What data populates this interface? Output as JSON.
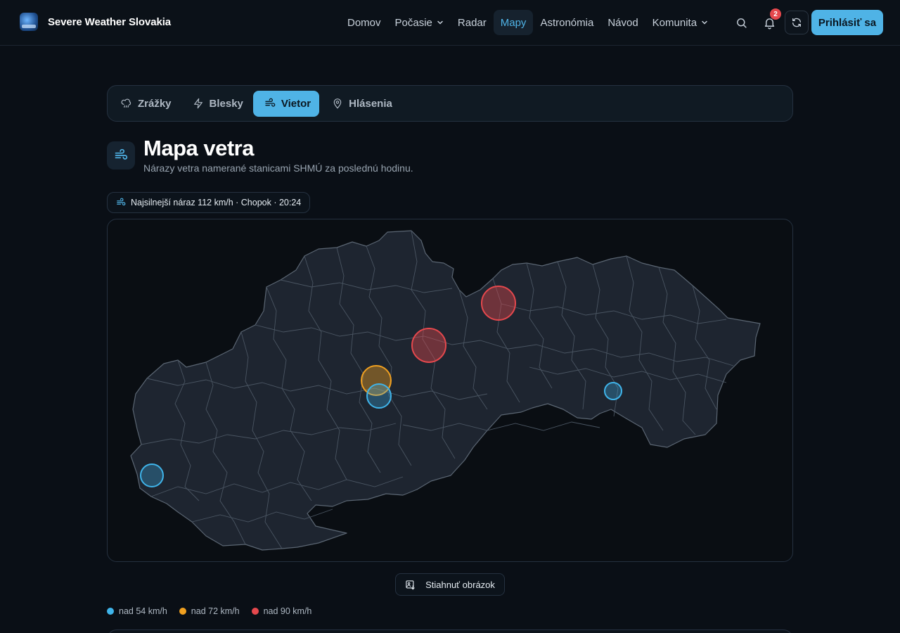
{
  "header": {
    "brand": "Severe Weather Slovakia",
    "nav": [
      {
        "label": "Domov",
        "dropdown": false,
        "active": false
      },
      {
        "label": "Počasie",
        "dropdown": true,
        "active": false
      },
      {
        "label": "Radar",
        "dropdown": false,
        "active": false
      },
      {
        "label": "Mapy",
        "dropdown": false,
        "active": true
      },
      {
        "label": "Astronómia",
        "dropdown": false,
        "active": false
      },
      {
        "label": "Návod",
        "dropdown": false,
        "active": false
      },
      {
        "label": "Komunita",
        "dropdown": true,
        "active": false
      }
    ],
    "notifications_count": "2",
    "login_label": "Prihlásiť sa",
    "icons": [
      "search-icon",
      "bell-icon",
      "refresh-icon"
    ]
  },
  "tabs": [
    {
      "label": "Zrážky",
      "icon": "rain-icon",
      "active": false
    },
    {
      "label": "Blesky",
      "icon": "lightning-icon",
      "active": false
    },
    {
      "label": "Vietor",
      "icon": "wind-icon",
      "active": true
    },
    {
      "label": "Hlásenia",
      "icon": "pin-icon",
      "active": false
    }
  ],
  "page": {
    "title": "Mapa vetra",
    "subtitle": "Nárazy vetra namerané stanicami SHMÚ za poslednú hodinu.",
    "strongest": "Najsilnejší náraz 112 km/h · Chopok · 20:24",
    "download_label": "Stiahnuť obrázok"
  },
  "legend": [
    {
      "label": "nad 54 km/h",
      "color": "#3fb4ea"
    },
    {
      "label": "nad 72 km/h",
      "color": "#f0a020"
    },
    {
      "label": "nad 90 km/h",
      "color": "#e5484d"
    }
  ],
  "colors": {
    "accent": "#4fb3e6",
    "map_fill": "#1e2530",
    "map_stroke": "#5b6673",
    "low": "#3fb4ea",
    "mid": "#f0a020",
    "high": "#e5484d"
  }
}
